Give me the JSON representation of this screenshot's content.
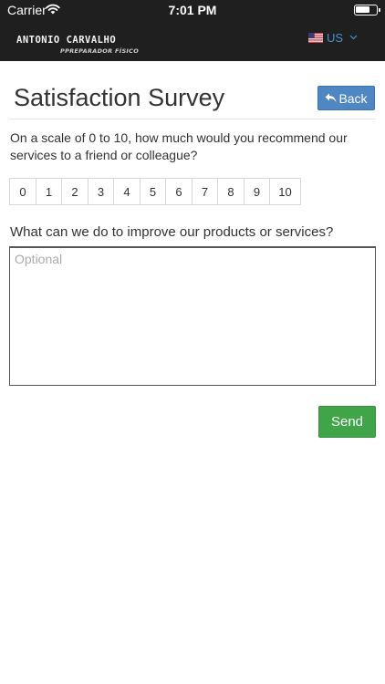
{
  "status_bar": {
    "carrier": "Carrier",
    "time": "7:01 PM",
    "wifi_icon": "wifi-icon",
    "battery_icon": "battery-icon"
  },
  "header": {
    "brand_name": "ANTONIO CARVALHO",
    "brand_tagline": "PPREPARADOR FÍSICO",
    "language": {
      "flag_icon": "us-flag-icon",
      "label": "US",
      "chevron_icon": "chevron-down-icon"
    },
    "background_color": "#1f1f1f",
    "accent_color": "#4a90d6"
  },
  "survey": {
    "title": "Satisfaction Survey",
    "back_label": "Back",
    "back_icon": "reply-icon",
    "back_color": "#4f87c3",
    "question": "On a scale of 0 to 10, how much would you recommend our services to a friend or colleague?",
    "scale": [
      "0",
      "1",
      "2",
      "3",
      "4",
      "5",
      "6",
      "7",
      "8",
      "9",
      "10"
    ],
    "improve_label": "What can we do to improve our products or services?",
    "comment_value": "",
    "comment_placeholder": "Optional",
    "send_label": "Send",
    "send_color": "#3fa548"
  }
}
